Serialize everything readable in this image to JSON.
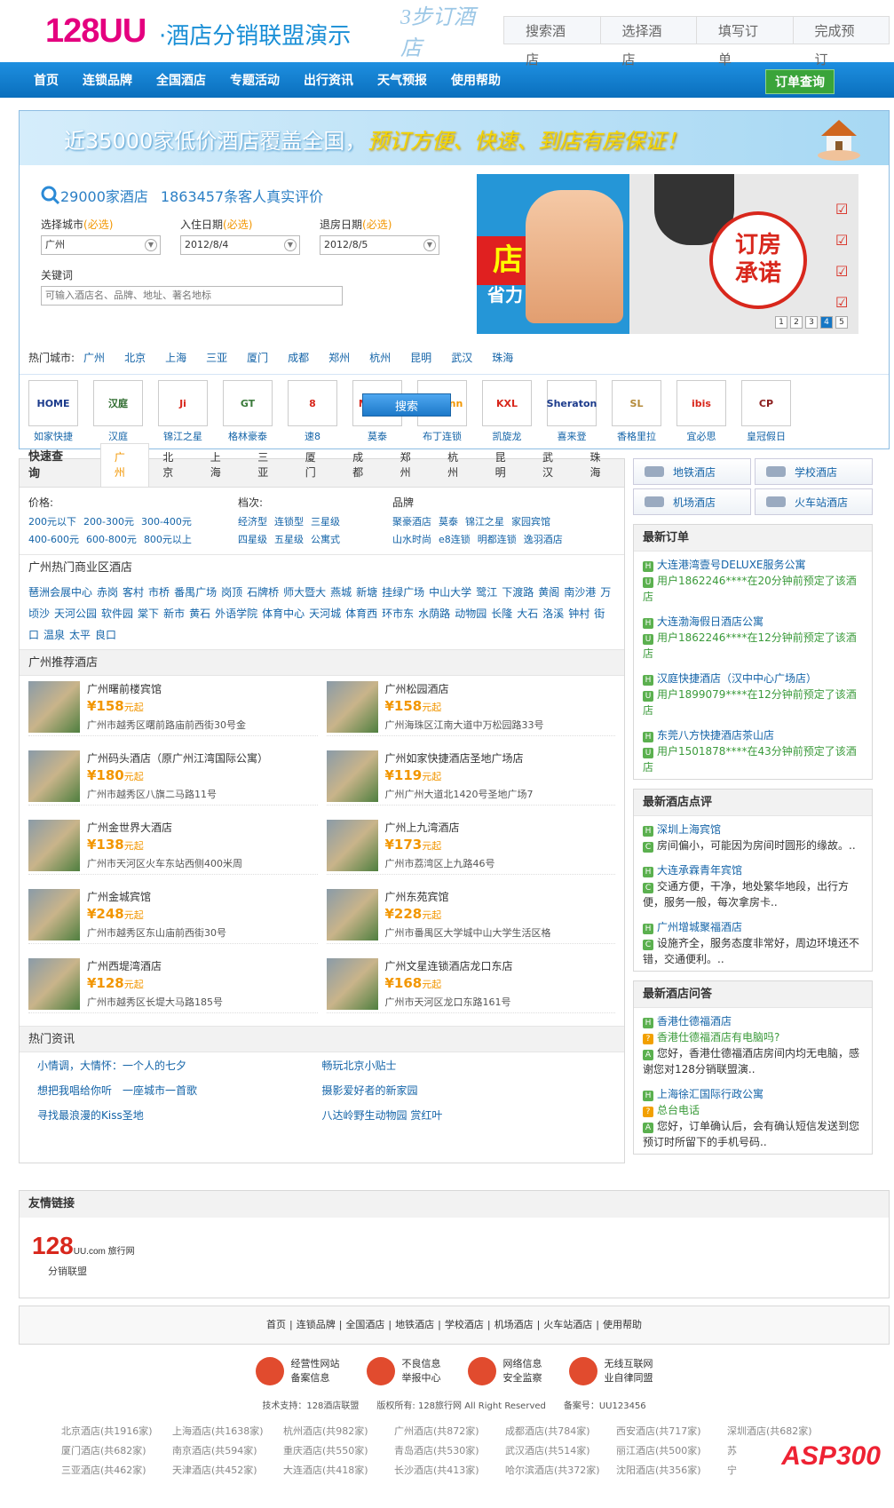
{
  "header": {
    "logo": "128UU",
    "logo_sub": "·酒店分销联盟演示",
    "steps_title": "3步订酒店",
    "steps": [
      "搜索酒店",
      "选择酒店",
      "填写订单",
      "完成预订"
    ]
  },
  "nav": {
    "items": [
      "首页",
      "连锁品牌",
      "全国酒店",
      "专题活动",
      "出行资讯",
      "天气预报",
      "使用帮助"
    ],
    "order_button": "订单查询"
  },
  "banner": {
    "text1": "近35000家低价酒店覆盖全国，",
    "text2": "预订方便、快速、到店有房保证！"
  },
  "search": {
    "stat1": "29000家酒店",
    "stat2": "1863457条客人真实评价",
    "city_label": "选择城市",
    "checkin_label": "入住日期",
    "checkout_label": "退房日期",
    "required": "(必选)",
    "city": "广州",
    "checkin": "2012/8/4",
    "checkout": "2012/8/5",
    "keyword_label": "关键词",
    "keyword_placeholder": "可输入酒店名、品牌、地址、著名地标",
    "button": "搜索"
  },
  "promo": {
    "tag": "店",
    "slogan": "省力",
    "seal": "订房\n承诺",
    "pages": [
      "1",
      "2",
      "3",
      "4",
      "5"
    ],
    "active_page": "4"
  },
  "hot_cities": {
    "label": "热门城市:",
    "items": [
      "广州",
      "北京",
      "上海",
      "三亚",
      "厦门",
      "成都",
      "郑州",
      "杭州",
      "昆明",
      "武汉",
      "珠海"
    ]
  },
  "brands": [
    {
      "name": "如家快捷",
      "logo": "HOME",
      "color": "#1c3b8c"
    },
    {
      "name": "汉庭",
      "logo": "汉庭",
      "color": "#2e6b2e"
    },
    {
      "name": "锦江之星",
      "logo": "Ji",
      "color": "#d8271c"
    },
    {
      "name": "格林豪泰",
      "logo": "GT",
      "color": "#3a7a3a"
    },
    {
      "name": "速8",
      "logo": "8",
      "color": "#d8271c"
    },
    {
      "name": "莫泰",
      "logo": "MOTEL",
      "color": "#d8271c"
    },
    {
      "name": "布丁连锁",
      "logo": "pod inn",
      "color": "#f29600"
    },
    {
      "name": "凯旋龙",
      "logo": "KXL",
      "color": "#d8271c"
    },
    {
      "name": "喜来登",
      "logo": "Sheraton",
      "color": "#1c3b8c"
    },
    {
      "name": "香格里拉",
      "logo": "SL",
      "color": "#b48a3a"
    },
    {
      "name": "宜必思",
      "logo": "ibis",
      "color": "#d8271c"
    },
    {
      "name": "皇冠假日",
      "logo": "CP",
      "color": "#8a1c1c"
    }
  ],
  "quick": {
    "title": "快速查询",
    "tabs": [
      "广州",
      "北京",
      "上海",
      "三亚",
      "厦门",
      "成都",
      "郑州",
      "杭州",
      "昆明",
      "武汉",
      "珠海"
    ],
    "price_label": "价格:",
    "prices": [
      "200元以下",
      "200-300元",
      "300-400元",
      "400-600元",
      "600-800元",
      "800元以上"
    ],
    "grade_label": "档次:",
    "grades": [
      "经济型",
      "连锁型",
      "三星级",
      "四星级",
      "五星级",
      "公寓式"
    ],
    "brand_label": "品牌",
    "brands": [
      "聚豪酒店",
      "莫泰",
      "锦江之星",
      "家园宾馆",
      "山水时尚",
      "e8连锁",
      "明都连锁",
      "逸羽酒店"
    ]
  },
  "business": {
    "title": "广州热门商业区酒店",
    "items": [
      "琶洲会展中心",
      "赤岗",
      "客村",
      "市桥",
      "番禺广场",
      "岗顶",
      "石牌桥",
      "师大暨大",
      "燕城",
      "新塘",
      "挂绿广场",
      "中山大学",
      "鹭江",
      "下渡路",
      "黄阁",
      "南沙港",
      "万顷沙",
      "天河公园",
      "软件园",
      "棠下",
      "新市",
      "黄石",
      "外语学院",
      "体育中心",
      "天河城",
      "体育西",
      "环市东",
      "水荫路",
      "动物园",
      "长隆",
      "大石",
      "洛溪",
      "钟村",
      "街口",
      "温泉",
      "太平",
      "良口"
    ]
  },
  "recommend": {
    "title": "广州推荐酒店",
    "unit": "元起",
    "hotels": [
      {
        "name": "广州曙前楼宾馆",
        "price": "¥158",
        "addr": "广州市越秀区曙前路庙前西街30号金"
      },
      {
        "name": "广州松园酒店",
        "price": "¥158",
        "addr": "广州海珠区江南大道中万松园路33号"
      },
      {
        "name": "广州码头酒店（原广州江湾国际公寓）",
        "price": "¥180",
        "addr": "广州市越秀区八旗二马路11号"
      },
      {
        "name": "广州如家快捷酒店圣地广场店",
        "price": "¥119",
        "addr": "广州广州大道北1420号圣地广场7"
      },
      {
        "name": "广州金世界大酒店",
        "price": "¥138",
        "addr": "广州市天河区火车东站西侧400米周"
      },
      {
        "name": "广州上九湾酒店",
        "price": "¥173",
        "addr": "广州市荔湾区上九路46号"
      },
      {
        "name": "广州金城宾馆",
        "price": "¥248",
        "addr": "广州市越秀区东山庙前西街30号"
      },
      {
        "name": "广州东苑宾馆",
        "price": "¥228",
        "addr": "广州市番禺区大学城中山大学生活区格"
      },
      {
        "name": "广州西堤湾酒店",
        "price": "¥128",
        "addr": "广州市越秀区长堤大马路185号"
      },
      {
        "name": "广州文星连锁酒店龙口东店",
        "price": "¥168",
        "addr": "广州市天河区龙口东路161号"
      }
    ]
  },
  "news": {
    "title": "热门资讯",
    "items": [
      "小情调，大情怀：一个人的七夕",
      "畅玩北京小贴士",
      "想把我唱给你听　一座城市一首歌",
      "摄影爱好者的新家园",
      "寻找最浪漫的Kiss圣地",
      "八达岭野生动物园 赏红叶"
    ]
  },
  "rnav": [
    "地铁酒店",
    "学校酒店",
    "机场酒店",
    "火车站酒店"
  ],
  "orders": {
    "title": "最新订单",
    "items": [
      {
        "hotel": "大连港湾壹号DELUXE服务公寓",
        "user": "用户1862246****在20分钟前预定了该酒店"
      },
      {
        "hotel": "大连渤海假日酒店公寓",
        "user": "用户1862246****在12分钟前预定了该酒店"
      },
      {
        "hotel": "汉庭快捷酒店（汉中中心广场店）",
        "user": "用户1899079****在12分钟前预定了该酒店"
      },
      {
        "hotel": "东莞八方快捷酒店茶山店",
        "user": "用户1501878****在43分钟前预定了该酒店"
      }
    ]
  },
  "reviews": {
    "title": "最新酒店点评",
    "items": [
      {
        "hotel": "深圳上海宾馆",
        "text": "房间偏小，可能因为房间时圆形的缘故。.."
      },
      {
        "hotel": "大连承霖青年宾馆",
        "text": "交通方便，干净，地处繁华地段，出行方便，服务一般，每次拿房卡.."
      },
      {
        "hotel": "广州增城聚福酒店",
        "text": "设施齐全，服务态度非常好，周边环境还不错，交通便利。.."
      }
    ]
  },
  "qa": {
    "title": "最新酒店问答",
    "items": [
      {
        "hotel": "香港仕德福酒店",
        "q": "香港仕德福酒店有电脑吗?",
        "a": "您好，香港仕德福酒店房间内均无电脑，感谢您对128分销联盟演.."
      },
      {
        "hotel": "上海徐汇国际行政公寓",
        "q": "总台电话",
        "a": "您好，订单确认后，会有确认短信发送到您预订时所留下的手机号码.."
      }
    ]
  },
  "links": {
    "title": "友情链接",
    "logo": "128",
    "logo_sub": "UU.com 旅行网",
    "text": "分销联盟"
  },
  "footer": {
    "nav": [
      "首页",
      "连锁品牌",
      "全国酒店",
      "地铁酒店",
      "学校酒店",
      "机场酒店",
      "火车站酒店",
      "使用帮助"
    ],
    "badges": [
      {
        "l1": "经营性网站",
        "l2": "备案信息"
      },
      {
        "l1": "不良信息",
        "l2": "举报中心"
      },
      {
        "l1": "网络信息",
        "l2": "安全监察"
      },
      {
        "l1": "无线互联网",
        "l2": "业自律同盟"
      }
    ],
    "copy": "技术支持：128酒店联盟　　版权所有: 128旅行网 All Right Reserved　　备案号：UU123456",
    "cities": [
      "北京酒店(共1916家)",
      "上海酒店(共1638家)",
      "杭州酒店(共982家)",
      "广州酒店(共872家)",
      "成都酒店(共784家)",
      "西安酒店(共717家)",
      "深圳酒店(共682家)",
      "厦门酒店(共682家)",
      "南京酒店(共594家)",
      "重庆酒店(共550家)",
      "青岛酒店(共530家)",
      "武汉酒店(共514家)",
      "丽江酒店(共500家)",
      "苏",
      "三亚酒店(共462家)",
      "天津酒店(共452家)",
      "大连酒店(共418家)",
      "长沙酒店(共413家)",
      "哈尔滨酒店(共372家)",
      "沈阳酒店(共356家)",
      "宁"
    ],
    "watermark": "ASP300"
  }
}
